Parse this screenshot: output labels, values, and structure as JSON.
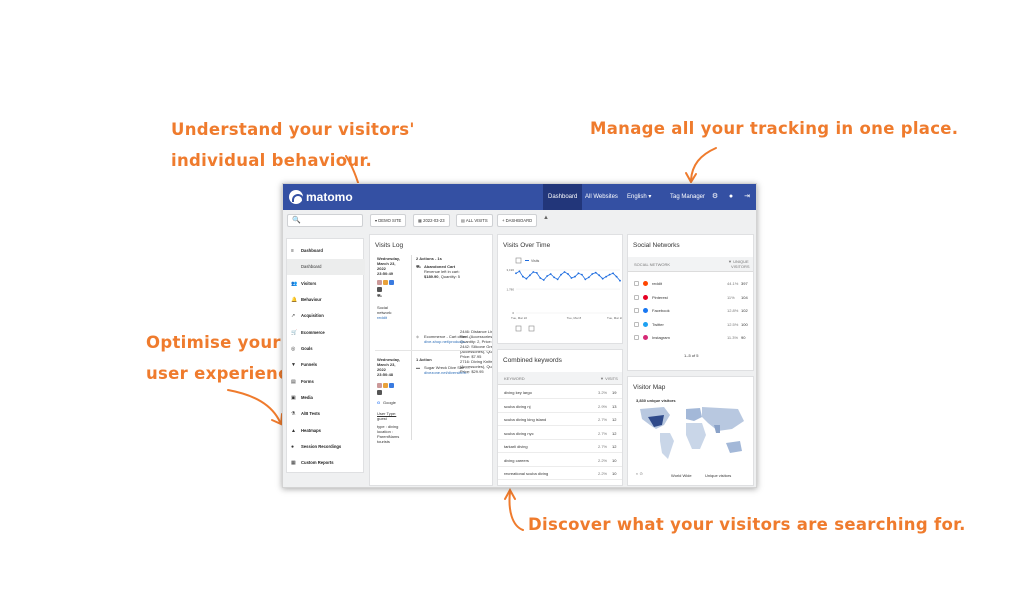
{
  "annotations": {
    "individual_1": "Understand your visitors'",
    "individual_2": "individual behaviour.",
    "tracking": "Manage all your tracking in one place.",
    "optimise_1": "Optimise your",
    "optimise_2": "user experience.",
    "discover": "Discover what your visitors are searching for.",
    "color": "#ef7b2d"
  },
  "topbar": {
    "brand": "matomo",
    "nav": [
      "Dashboard",
      "All Websites",
      "English ▾",
      "Tag Manager"
    ],
    "icons": [
      "gear-icon",
      "help-icon",
      "logout-icon"
    ],
    "bg": "#3450a3"
  },
  "toolbar": {
    "search_icon": "🔍",
    "site": "DEMO SITE",
    "date": "2022-03-23",
    "segment": "ALL VISITS",
    "dashboard": "DASHBOARD"
  },
  "sidebar": {
    "items": [
      {
        "label": "Dashboard",
        "icon": "≡"
      },
      {
        "label": "Dashboard",
        "icon": ""
      },
      {
        "label": "Visitors",
        "icon": "👥"
      },
      {
        "label": "Behaviour",
        "icon": "🔔"
      },
      {
        "label": "Acquisition",
        "icon": "↗"
      },
      {
        "label": "Ecommerce",
        "icon": "🛒"
      },
      {
        "label": "Goals",
        "icon": "◎"
      },
      {
        "label": "Funnels",
        "icon": "▼"
      },
      {
        "label": "Forms",
        "icon": "▤"
      },
      {
        "label": "Media",
        "icon": "▣"
      },
      {
        "label": "A/B Tests",
        "icon": "⚗"
      },
      {
        "label": "Heatmaps",
        "icon": "▲"
      },
      {
        "label": "Session Recordings",
        "icon": "●"
      },
      {
        "label": "Custom Reports",
        "icon": "▦"
      }
    ]
  },
  "visits_log": {
    "title": "Visits Log",
    "visit1": {
      "date_line1": "Wednesday,",
      "date_line2": "March 23,",
      "date_line3": "2022",
      "time": "23:50:49",
      "social_1": "Social",
      "social_2": "network:",
      "social_3": "reddit",
      "actions": "2 Actions - 1s",
      "abandoned": "Abandoned Cart",
      "revenue_label": "Revenue left in cart:",
      "revenue": "$189.90",
      "quantity": ", Quantity: 5",
      "items": [
        "2446: Distance Line &",
        "Reel (Accessories),",
        "Quantity: 2, Price: $54.95",
        "2442: Silicone Grease",
        "(Accessories), Quantity: 1,",
        "Price: $7.95",
        "2716: Diving Knife",
        "(Accessories), Quantity: 1,",
        "Price: $29.95"
      ],
      "ecom_1": "Ecommerce - Cart chan...",
      "ecom_2": "dive-shop.net/products..."
    },
    "visit2": {
      "date_line1": "Wednesday,",
      "date_line2": "March 23,",
      "date_line3": "2022",
      "time": "23:50:48",
      "actions": "1 Action",
      "page_1": "Sugar Wreck Dive Site -...",
      "page_2": "divezone.net/diversite/s...",
      "referrer": "Google",
      "usertype_label": "User Type:",
      "usertype": "guest",
      "type_label": "type : diving",
      "location_1": "location :",
      "location_2": "ParentNams",
      "location_3": "tourists"
    }
  },
  "visits_over_time": {
    "title": "Visits Over Time",
    "legend": "Visits",
    "y_ticks": [
      "3,196",
      "1,780",
      "0"
    ],
    "x_ticks": [
      "Tue, Mar 22",
      "Tue, Mar 8",
      "Tue, Mar 22"
    ]
  },
  "chart_data": {
    "type": "line",
    "ylabel": "",
    "ylim": [
      0,
      3196
    ],
    "series": [
      {
        "name": "Visits",
        "values": [
          2950,
          3100,
          2700,
          2550,
          2800,
          3050,
          2980,
          2600,
          2450,
          2750,
          2900,
          2650,
          2500,
          2850,
          3050,
          2900,
          2600,
          2700,
          2950,
          2850,
          2500,
          2650,
          2900,
          3000,
          2800,
          2550,
          2700,
          2850,
          2950,
          2700,
          2400
        ]
      }
    ],
    "x_tick_labels": [
      "Tue, Mar 22",
      "Tue, Mar 8",
      "Tue, Mar 22"
    ]
  },
  "keywords": {
    "title": "Combined keywords",
    "col_keyword": "KEYWORD",
    "col_visits": "▼ VISITS",
    "rows": [
      {
        "keyword": "diving key largo",
        "pct": "3.2%",
        "visits": "19"
      },
      {
        "keyword": "scuba diving nj",
        "pct": "2.9%",
        "visits": "13"
      },
      {
        "keyword": "scuba diving king island",
        "pct": "2.7%",
        "visits": "12"
      },
      {
        "keyword": "scuba diving nyc",
        "pct": "2.7%",
        "visits": "12"
      },
      {
        "keyword": "tarkarli diving",
        "pct": "2.7%",
        "visits": "12"
      },
      {
        "keyword": "diving careers",
        "pct": "2.2%",
        "visits": "10"
      },
      {
        "keyword": "recreational scuba diving",
        "pct": "2.2%",
        "visits": "10"
      }
    ]
  },
  "social": {
    "title": "Social Networks",
    "col_network": "SOCIAL NETWORK",
    "col_visitors_1": "▼ UNIQUE",
    "col_visitors_2": "VISITORS",
    "rows": [
      {
        "name": "reddit",
        "pct": "44.1%",
        "value": "397",
        "color": "#ff4500"
      },
      {
        "name": "Pinterest",
        "pct": "11%",
        "value": "104",
        "color": "#e60023"
      },
      {
        "name": "Facebook",
        "pct": "12.8%",
        "value": "102",
        "color": "#1877f2"
      },
      {
        "name": "Twitter",
        "pct": "12.5%",
        "value": "100",
        "color": "#1da1f2"
      },
      {
        "name": "Instagram",
        "pct": "11.3%",
        "value": "90",
        "color": "#d62976"
      }
    ],
    "pagination": "1–5 of 5"
  },
  "visitor_map": {
    "title": "Visitor Map",
    "unique_visitors": "3,830 unique visitors",
    "region": "World Wide",
    "metric": "Unique visitors"
  }
}
